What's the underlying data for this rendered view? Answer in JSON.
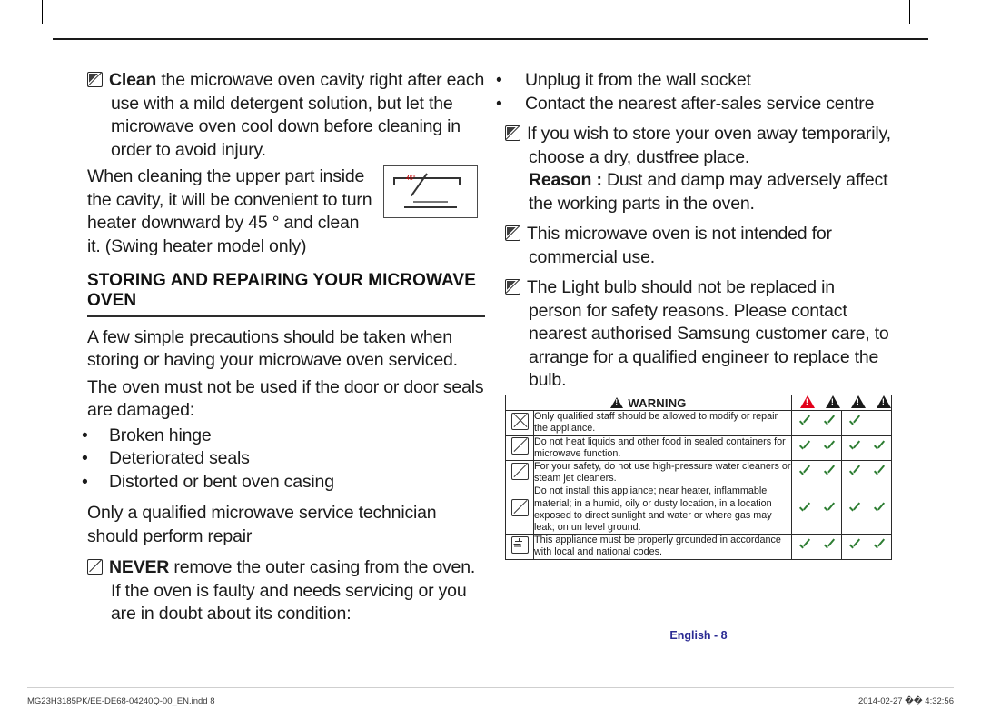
{
  "page": {
    "number_label": "English - 8"
  },
  "left_column": {
    "p_clean": {
      "lead": "Clean",
      "rest": " the microwave oven cavity right after each use with a mild detergent solution, but let the microwave oven cool down before cleaning in order to avoid injury."
    },
    "p_upper": "When cleaning the upper part inside the cavity, it will be convenient to turn heater downward by 45 ° and clean it. (Swing heater model only)",
    "figure_label": "45°",
    "heading": "STORING AND REPAIRING YOUR MICROWAVE OVEN",
    "p_precautions": "A few simple precautions should be taken when storing or having your microwave oven serviced.",
    "p_seals": "The oven must not be used if the door or door seals are damaged:",
    "bullets": [
      "Broken hinge",
      "Deteriorated seals",
      "Distorted or bent oven casing"
    ],
    "p_technician": "Only a qualified microwave service technician should perform repair",
    "p_never": {
      "lead": "NEVER",
      "rest": " remove the outer casing from the oven. If the oven is faulty and needs servicing or you are in doubt about its condition:"
    }
  },
  "right_column": {
    "bullets": [
      "Unplug it from the wall socket",
      "Contact the nearest after-sales service centre"
    ],
    "p_store": "If you wish to store your oven away temporarily, choose a dry, dustfree place.",
    "p_reason": {
      "lead": "Reason :",
      "rest": " Dust and damp may adversely affect the working parts in the oven."
    },
    "p_commercial": "This microwave oven is not intended for commercial use.",
    "p_bulb": "The Light bulb should not be replaced in person for safety reasons. Please contact nearest authorised Samsung customer care, to arrange for a qualified engineer to replace the bulb."
  },
  "warning_table": {
    "title": "WARNING",
    "rows": [
      {
        "icon": "no-modify-icon",
        "text": "Only qualified staff should be allowed to modify or repair the appliance.",
        "checks": [
          true,
          true,
          true,
          false
        ]
      },
      {
        "icon": "no-sealed-container-icon",
        "text": "Do not heat liquids and other food in sealed containers for microwave function.",
        "checks": [
          true,
          true,
          true,
          true
        ]
      },
      {
        "icon": "no-high-pressure-water-icon",
        "text": "For your safety, do not use high-pressure water cleaners or steam jet cleaners.",
        "checks": [
          true,
          true,
          true,
          true
        ]
      },
      {
        "icon": "no-install-near-heater-icon",
        "text": "Do not install this appliance; near heater, inflammable material; in a humid, oily or dusty location, in a location exposed to direct sunlight and water or where gas may leak; on un level ground.",
        "checks": [
          true,
          true,
          true,
          true
        ]
      },
      {
        "icon": "ground-icon",
        "text": "This appliance must be properly grounded in accordance with local and national codes.",
        "checks": [
          true,
          true,
          true,
          true
        ]
      }
    ]
  },
  "footer": {
    "left": "MG23H3185PK/EE-DE68-04240Q-00_EN.indd   8",
    "right": "2014-02-27   �� 4:32:56"
  }
}
